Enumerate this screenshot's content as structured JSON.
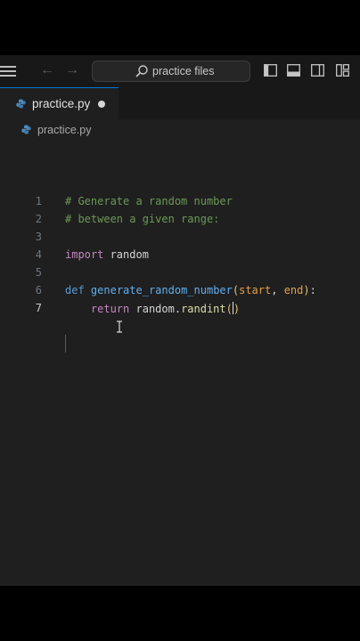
{
  "search": {
    "text": "practice files"
  },
  "tab": {
    "label": "practice.py"
  },
  "breadcrumb": {
    "file": "practice.py"
  },
  "editor": {
    "lines": [
      {
        "num": "1",
        "tokens": [
          [
            "c-comment",
            "# Generate a random number"
          ]
        ]
      },
      {
        "num": "2",
        "tokens": [
          [
            "c-comment",
            "# between a given range:"
          ]
        ]
      },
      {
        "num": "3",
        "tokens": []
      },
      {
        "num": "4",
        "tokens": [
          [
            "c-kw",
            "import"
          ],
          [
            "c-plain",
            " random"
          ]
        ]
      },
      {
        "num": "5",
        "tokens": []
      },
      {
        "num": "6",
        "tokens": [
          [
            "c-def",
            "def"
          ],
          [
            "c-plain",
            " "
          ],
          [
            "c-fn",
            "generate_random_number"
          ],
          [
            "c-paren",
            "("
          ],
          [
            "c-param",
            "start"
          ],
          [
            "c-plain",
            ", "
          ],
          [
            "c-param",
            "end"
          ],
          [
            "c-paren",
            ")"
          ],
          [
            "c-plain",
            ":"
          ]
        ]
      },
      {
        "num": "7",
        "tokens": [
          [
            "c-plain",
            "    "
          ],
          [
            "c-kw",
            "return"
          ],
          [
            "c-plain",
            " random."
          ],
          [
            "c-method",
            "randint"
          ],
          [
            "c-paren",
            "("
          ],
          [
            "caret",
            ""
          ],
          [
            "c-paren",
            ")"
          ]
        ]
      }
    ]
  },
  "colors": {
    "accent": "#0078d4",
    "python_icon": "#4b8bbe"
  }
}
